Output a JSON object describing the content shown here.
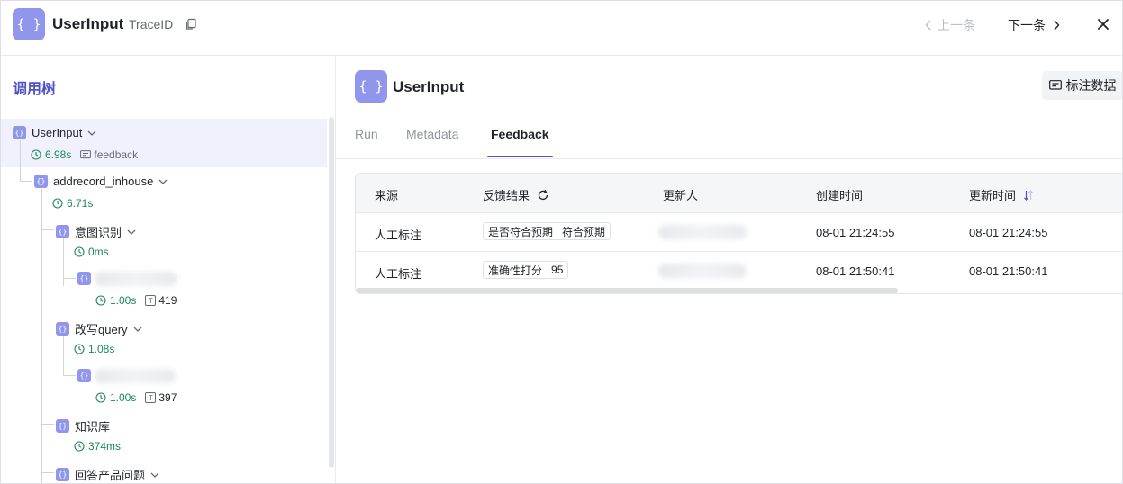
{
  "header": {
    "icon_label": "{ }",
    "title": "UserInput",
    "trace_label": "TraceID",
    "prev_label": "上一条",
    "next_label": "下一条"
  },
  "tree": {
    "title": "调用树",
    "nodes": [
      {
        "name": "UserInput",
        "duration": "6.98s",
        "tag": "feedback"
      },
      {
        "name": "addrecord_inhouse",
        "duration": "6.71s"
      },
      {
        "name": "意图识别",
        "duration": "0ms"
      },
      {
        "name": "",
        "duration": "1.00s",
        "tokens": "419"
      },
      {
        "name": "改写query",
        "duration": "1.08s"
      },
      {
        "name": "",
        "duration": "1.00s",
        "tokens": "397"
      },
      {
        "name": "知识库",
        "duration": "374ms"
      },
      {
        "name": "回答产品问题"
      }
    ],
    "token_glyph": "T"
  },
  "detail": {
    "icon_label": "{ }",
    "title": "UserInput",
    "annotate_button": "标注数据",
    "tabs": [
      {
        "label": "Run"
      },
      {
        "label": "Metadata"
      },
      {
        "label": "Feedback",
        "active": true
      }
    ],
    "table": {
      "columns": [
        "来源",
        "反馈结果",
        "更新人",
        "创建时间",
        "更新时间"
      ],
      "rows": [
        {
          "source": "人工标注",
          "result_key": "是否符合预期",
          "result_value": "符合预期",
          "updater": "",
          "created": "08-01 21:24:55",
          "updated": "08-01 21:24:55"
        },
        {
          "source": "人工标注",
          "result_key": "准确性打分",
          "result_value": "95",
          "updater": "",
          "created": "08-01 21:50:41",
          "updated": "08-01 21:50:41"
        }
      ]
    }
  },
  "colors": {
    "accent": "#4e54c8",
    "node_icon": "#8f96ec",
    "duration_green": "#1a8a56"
  },
  "icons": [
    "copy-icon",
    "chevron-left-icon",
    "chevron-right-icon",
    "close-icon",
    "chevron-down-icon",
    "clock-icon",
    "comment-icon",
    "refresh-icon",
    "sort-icon",
    "annotate-icon",
    "token-icon"
  ]
}
